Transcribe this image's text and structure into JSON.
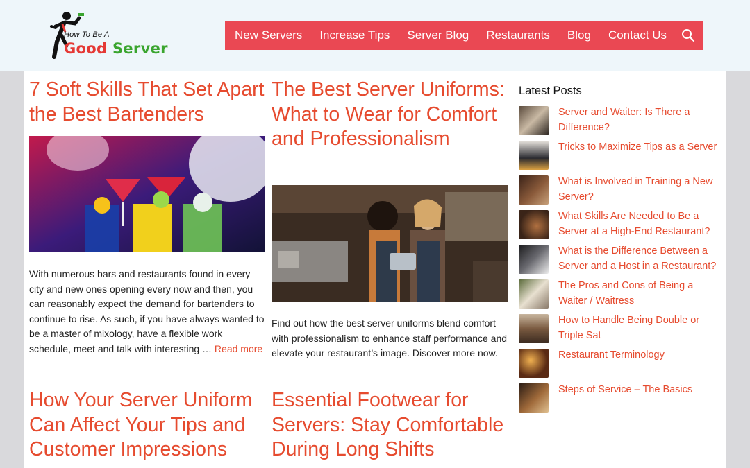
{
  "site": {
    "logo_tagline": "How To Be A",
    "logo_word1": "Good",
    "logo_word2": "Server"
  },
  "nav": {
    "items": [
      "New Servers",
      "Increase Tips",
      "Server Blog",
      "Restaurants",
      "Blog",
      "Contact Us"
    ],
    "search_icon": "search-icon"
  },
  "articles": [
    {
      "title": "7 Soft Skills That Set Apart the Best Bartenders",
      "excerpt": "With numerous bars and restaurants found in every city and new ones opening every now and then, you can reasonably expect the demand for bartenders to continue to rise. As such, if you have always wanted to be a master of mixology, have a flexible work schedule, meet and talk with interesting …",
      "read_more": "Read more"
    },
    {
      "title": "The Best Server Uniforms: What to Wear for Comfort and Professionalism",
      "excerpt": "Find out how the best server uniforms blend comfort with professionalism to enhance staff performance and elevate your restaurant’s image. Discover more now."
    },
    {
      "title": "How Your Server Uniform Can Affect Your Tips and Customer Impressions"
    },
    {
      "title": "Essential Footwear for Servers: Stay Comfortable During Long Shifts"
    }
  ],
  "sidebar": {
    "title": "Latest Posts",
    "posts": [
      "Server and Waiter: Is There a Difference?",
      "Tricks to Maximize Tips as a Server",
      "What is Involved in Training a New Server?",
      "What Skills Are Needed to Be a Server at a High-End Restaurant?",
      "What is the Difference Between a Server and a Host in a Restaurant?",
      "The Pros and Cons of Being a Waiter / Waitress",
      "How to Handle Being Double or Triple Sat",
      "Restaurant Terminology",
      "Steps of Service – The Basics"
    ]
  },
  "colors": {
    "accent": "#ea4853",
    "link": "#e64b2f",
    "header_bg": "#eef6fa",
    "page_bg": "#d9d9dc"
  }
}
